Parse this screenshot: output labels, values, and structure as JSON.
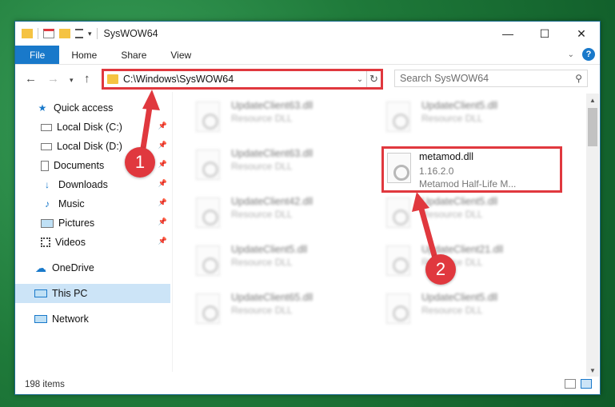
{
  "window": {
    "title": "SysWOW64"
  },
  "ribbon": {
    "tabs": [
      "File",
      "Home",
      "Share",
      "View"
    ],
    "help": "?"
  },
  "nav": {
    "address": "C:\\Windows\\SysWOW64",
    "search_placeholder": "Search SysWOW64"
  },
  "sidebar": {
    "items": [
      {
        "label": "Quick access",
        "icon": "star-icon"
      },
      {
        "label": "Local Disk (C:)",
        "icon": "drive-icon",
        "pinned": true
      },
      {
        "label": "Local Disk (D:)",
        "icon": "drive-icon",
        "pinned": true
      },
      {
        "label": "Documents",
        "icon": "documents-icon",
        "pinned": true
      },
      {
        "label": "Downloads",
        "icon": "download-icon",
        "pinned": true
      },
      {
        "label": "Music",
        "icon": "music-icon",
        "pinned": true
      },
      {
        "label": "Pictures",
        "icon": "pictures-icon",
        "pinned": true
      },
      {
        "label": "Videos",
        "icon": "videos-icon",
        "pinned": true
      },
      {
        "label": "OneDrive",
        "icon": "cloud-icon"
      },
      {
        "label": "This PC",
        "icon": "computer-icon",
        "selected": true
      },
      {
        "label": "Network",
        "icon": "network-icon"
      }
    ]
  },
  "files": [
    {
      "name": "UpdateClient63.dll",
      "type": "Resource DLL"
    },
    {
      "name": "UpdateClient5.dll",
      "type": "Resource DLL"
    },
    {
      "name": "UpdateClient63.dll",
      "type": "Resource DLL"
    },
    {
      "name": "metamod.dll",
      "type": "1.16.2.0",
      "desc": "Metamod Half-Life M...",
      "highlighted": true
    },
    {
      "name": "UpdateClient42.dll",
      "type": "Resource DLL"
    },
    {
      "name": "UpdateClient5.dll",
      "type": "Resource DLL"
    },
    {
      "name": "UpdateClient5.dll",
      "type": "Resource DLL"
    },
    {
      "name": "UpdateClient21.dll",
      "type": "Resource DLL"
    },
    {
      "name": "UpdateClient65.dll",
      "type": "Resource DLL"
    },
    {
      "name": "UpdateClient5.dll",
      "type": "Resource DLL"
    }
  ],
  "status": {
    "count": "198 items"
  },
  "callouts": [
    "1",
    "2"
  ],
  "colors": {
    "accent": "#1979ca",
    "highlight": "#e0383e",
    "selected": "#cce4f7"
  }
}
